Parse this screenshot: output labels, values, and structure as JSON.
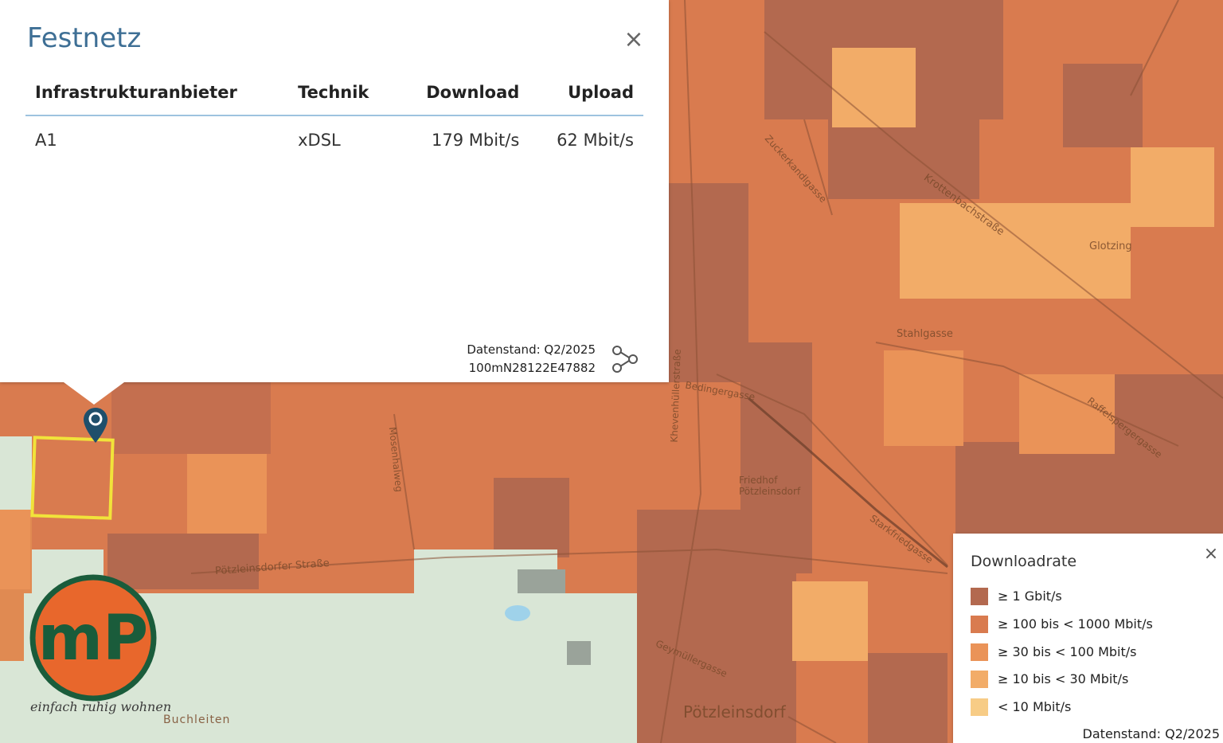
{
  "popup": {
    "title": "Festnetz",
    "close_symbol": "×",
    "columns": [
      "Infrastrukturanbieter",
      "Technik",
      "Download",
      "Upload"
    ],
    "rows": [
      [
        "A1",
        "xDSL",
        "179 Mbit/s",
        "62 Mbit/s"
      ]
    ],
    "stamp_date": "Datenstand: Q2/2025",
    "stamp_id": "100mN28122E47882",
    "share_icon": "share-icon"
  },
  "legend": {
    "title": "Downloadrate",
    "close_symbol": "×",
    "items": [
      {
        "label": "≥ 1 Gbit/s",
        "color": "#b3694f"
      },
      {
        "label": "≥ 100 bis < 1000 Mbit/s",
        "color": "#d97b4f"
      },
      {
        "label": "≥ 30 bis < 100 Mbit/s",
        "color": "#ea9358"
      },
      {
        "label": "≥ 10 bis < 30 Mbit/s",
        "color": "#f2ac68"
      },
      {
        "label": "< 10 Mbit/s",
        "color": "#f7cc86"
      }
    ],
    "stamp": "Datenstand: Q2/2025"
  },
  "logo": {
    "letters": "mP",
    "tagline": "einfach ruhig wohnen",
    "ring_color": "#1a5c3b",
    "fill_color": "#e8672c"
  },
  "map": {
    "labels": [
      "Buchleiten",
      "Pötzleinsdorf",
      "Pötzleinsdorfer Straße",
      "Krottenbachstraße",
      "Glotzing",
      "Stahlgasse",
      "Khevenhüllerstraße",
      "Friedhof Pötzleinsdorf",
      "Starkfriedgasse",
      "Raffelspergergasse",
      "Geymüllergasse",
      "Zuckerkandlgasse",
      "Bedingergasse",
      "Mosenhalweg"
    ],
    "colors": {
      "very_high": "#b3694f",
      "high": "#d97b4f",
      "medium": "#ea9358",
      "low": "#f2ac68",
      "very_low": "#f7cc86",
      "park": "#d9e6d6"
    },
    "marker_color": "#1f4f6b",
    "selection_color": "#f1e33a"
  }
}
